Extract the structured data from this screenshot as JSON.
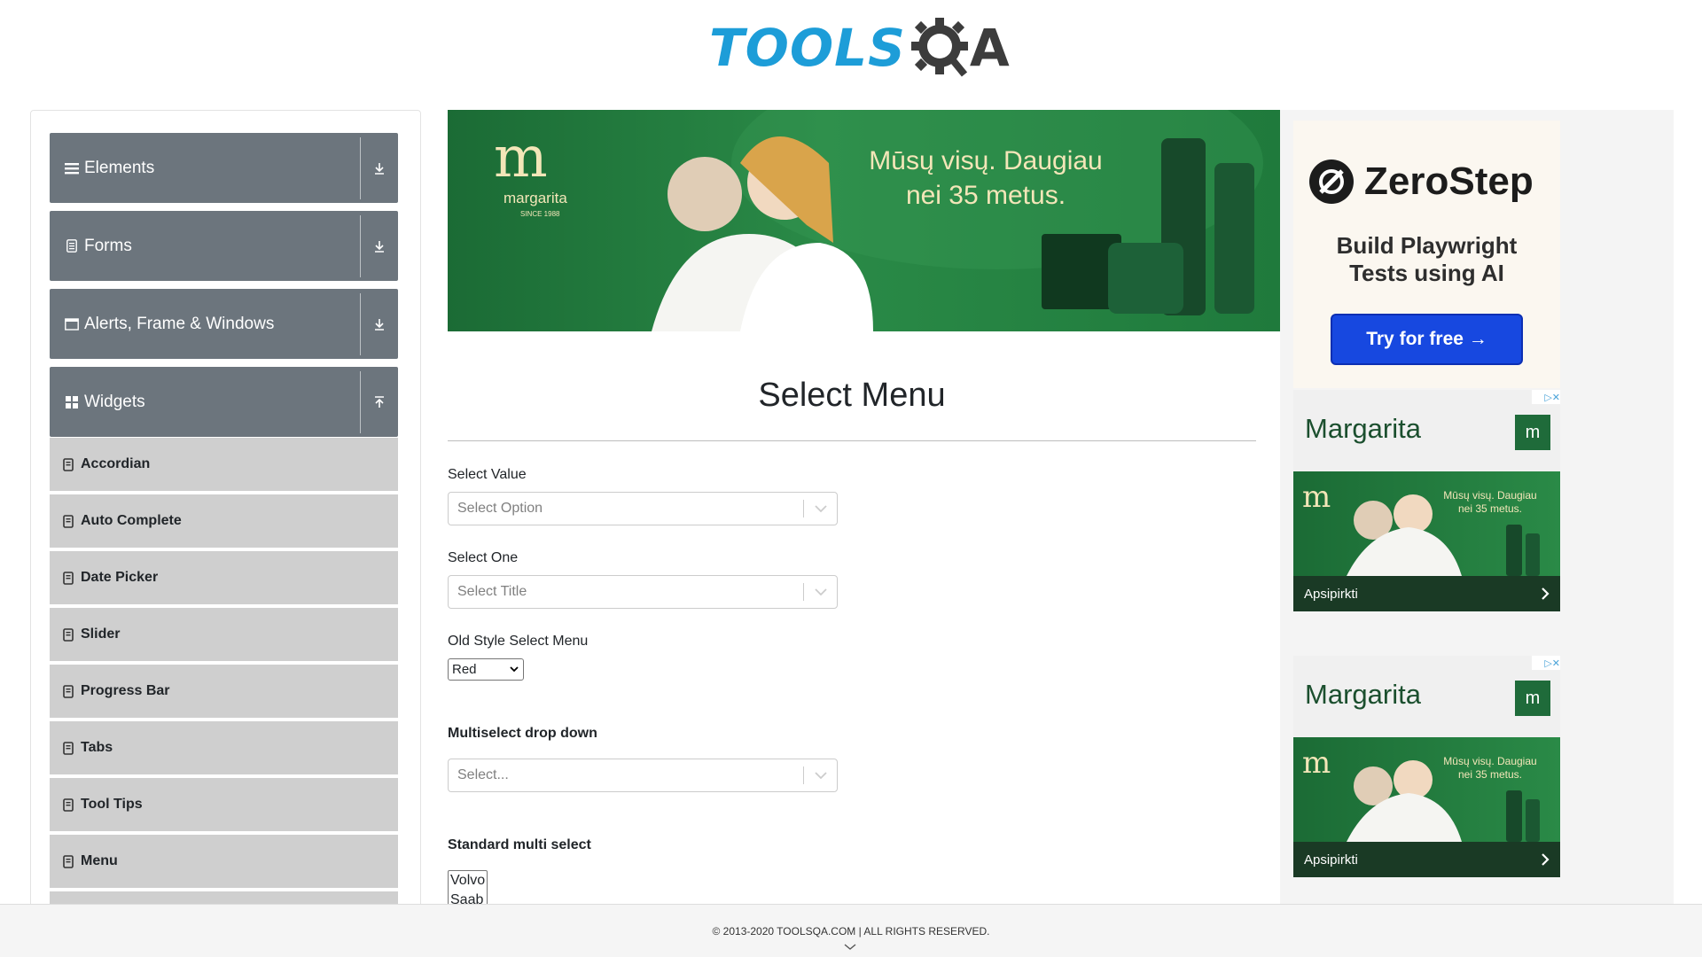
{
  "header": {
    "logo_main": "TOOLS",
    "logo_end": "A"
  },
  "sidebar": {
    "groups": [
      {
        "label": "Elements",
        "icon": "menu-icon",
        "arrow": "down"
      },
      {
        "label": "Forms",
        "icon": "form-icon",
        "arrow": "down"
      },
      {
        "label": "Alerts, Frame & Windows",
        "icon": "window-icon",
        "arrow": "down"
      },
      {
        "label": "Widgets",
        "icon": "widgets-icon",
        "arrow": "up"
      }
    ],
    "items": [
      {
        "label": "Accordian"
      },
      {
        "label": "Auto Complete"
      },
      {
        "label": "Date Picker"
      },
      {
        "label": "Slider"
      },
      {
        "label": "Progress Bar"
      },
      {
        "label": "Tabs"
      },
      {
        "label": "Tool Tips"
      },
      {
        "label": "Menu"
      }
    ]
  },
  "banner": {
    "brand": "margarita",
    "brand_since": "SINCE 1988",
    "headline": "Mūsų visų. Daugiau nei 35 metus."
  },
  "main": {
    "title": "Select Menu",
    "select_value_label": "Select Value",
    "select_value_placeholder": "Select Option",
    "select_one_label": "Select One",
    "select_one_placeholder": "Select Title",
    "old_style_label": "Old Style Select Menu",
    "old_style_value": "Red",
    "multiselect_label": "Multiselect drop down",
    "multiselect_placeholder": "Select...",
    "standard_multi_label": "Standard multi select",
    "standard_multi_options": [
      "Volvo",
      "Saab"
    ]
  },
  "ads": {
    "zerostep": {
      "name": "ZeroStep",
      "subtitle_line1": "Build Playwright",
      "subtitle_line2": "Tests using AI",
      "button": "Try for free →"
    },
    "margarita1": {
      "brand": "Margarita",
      "img_text": "Mūsų visų. Daugiau nei 35 metus.",
      "cta": "Apsipirkti"
    },
    "margarita2": {
      "brand": "Margarita",
      "img_text": "Mūsų visų. Daugiau nei 35 metus.",
      "cta": "Apsipirkti"
    }
  },
  "footer": {
    "text": "© 2013-2020 TOOLSQA.COM | ALL RIGHTS RESERVED."
  },
  "colors": {
    "brand_blue": "#1d9dd8",
    "group_gray": "#6c757d",
    "item_gray": "#cfcfcf",
    "ad_green": "#1f6b3a",
    "cta_blue": "#1748e0"
  }
}
